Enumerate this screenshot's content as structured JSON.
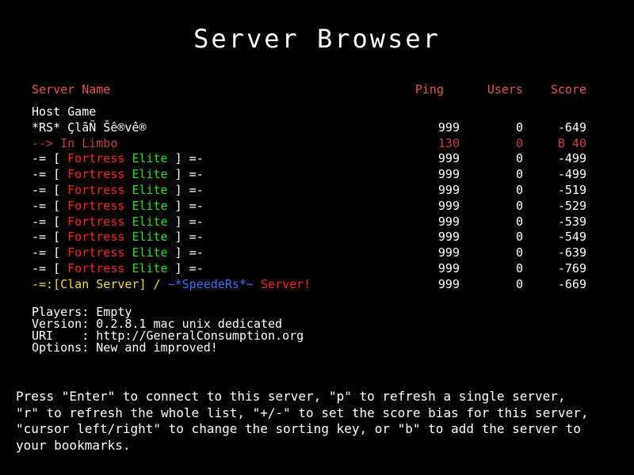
{
  "title": "Server Browser",
  "columns": {
    "name": "Server Name",
    "ping": "Ping",
    "users": "Users",
    "score": "Score"
  },
  "rows": [
    {
      "type": "plain",
      "name": "Host Game",
      "ping": "",
      "users": "",
      "score": ""
    },
    {
      "type": "plain",
      "name": "*RS* ÇlãÑ Šê®vê®",
      "ping": "999",
      "users": "0",
      "score": "-649"
    },
    {
      "type": "limbo",
      "name": "--> In Limbo",
      "ping": "130",
      "users": "0",
      "score": "B 40"
    },
    {
      "type": "fortress",
      "name_parts": [
        "-= [ ",
        "Fortress",
        " ",
        "Elite",
        " ] =-"
      ],
      "ping": "999",
      "users": "0",
      "score": "-499"
    },
    {
      "type": "fortress",
      "name_parts": [
        "-= [ ",
        "Fortress",
        " ",
        "Elite",
        " ] =-"
      ],
      "ping": "999",
      "users": "0",
      "score": "-499"
    },
    {
      "type": "fortress",
      "name_parts": [
        "-= [ ",
        "Fortress",
        " ",
        "Elite",
        " ] =-"
      ],
      "ping": "999",
      "users": "0",
      "score": "-519"
    },
    {
      "type": "fortress",
      "name_parts": [
        "-= [ ",
        "Fortress",
        " ",
        "Elite",
        " ] =-"
      ],
      "ping": "999",
      "users": "0",
      "score": "-529"
    },
    {
      "type": "fortress",
      "name_parts": [
        "-= [ ",
        "Fortress",
        " ",
        "Elite",
        " ] =-"
      ],
      "ping": "999",
      "users": "0",
      "score": "-539"
    },
    {
      "type": "fortress",
      "name_parts": [
        "-= [ ",
        "Fortress",
        " ",
        "Elite",
        " ] =-"
      ],
      "ping": "999",
      "users": "0",
      "score": "-549"
    },
    {
      "type": "fortress",
      "name_parts": [
        "-= [ ",
        "Fortress",
        " ",
        "Elite",
        " ] =-"
      ],
      "ping": "999",
      "users": "0",
      "score": "-639"
    },
    {
      "type": "fortress",
      "name_parts": [
        "-= [ ",
        "Fortress",
        " ",
        "Elite",
        " ] =-"
      ],
      "ping": "999",
      "users": "0",
      "score": "-769"
    },
    {
      "type": "clan",
      "name_parts": [
        "-=:[Clan Server] / ",
        "~*SpeedeRs*~",
        " Server!"
      ],
      "ping": "999",
      "users": "0",
      "score": "-669"
    }
  ],
  "details": {
    "players": "Players: Empty",
    "version": "Version: 0.2.8.1 mac unix dedicated",
    "uri": "URI    : http://GeneralConsumption.org",
    "options": "Options: New and improved!"
  },
  "help_text": "Press \"Enter\" to connect to this server, \"p\" to refresh a single server,\n\"r\" to refresh the whole list, \"+/-\" to set the score bias for this server,\n\"cursor left/right\" to change the sorting key, or \"b\" to add the server to\nyour bookmarks.",
  "colors": {
    "background": "#000000",
    "header": "#e05555",
    "limbo": "#c04040",
    "fortress_red": "#ff2020",
    "fortress_green": "#20e020",
    "clan_yellow": "#f0e020",
    "clan_blue": "#3a70ff"
  }
}
